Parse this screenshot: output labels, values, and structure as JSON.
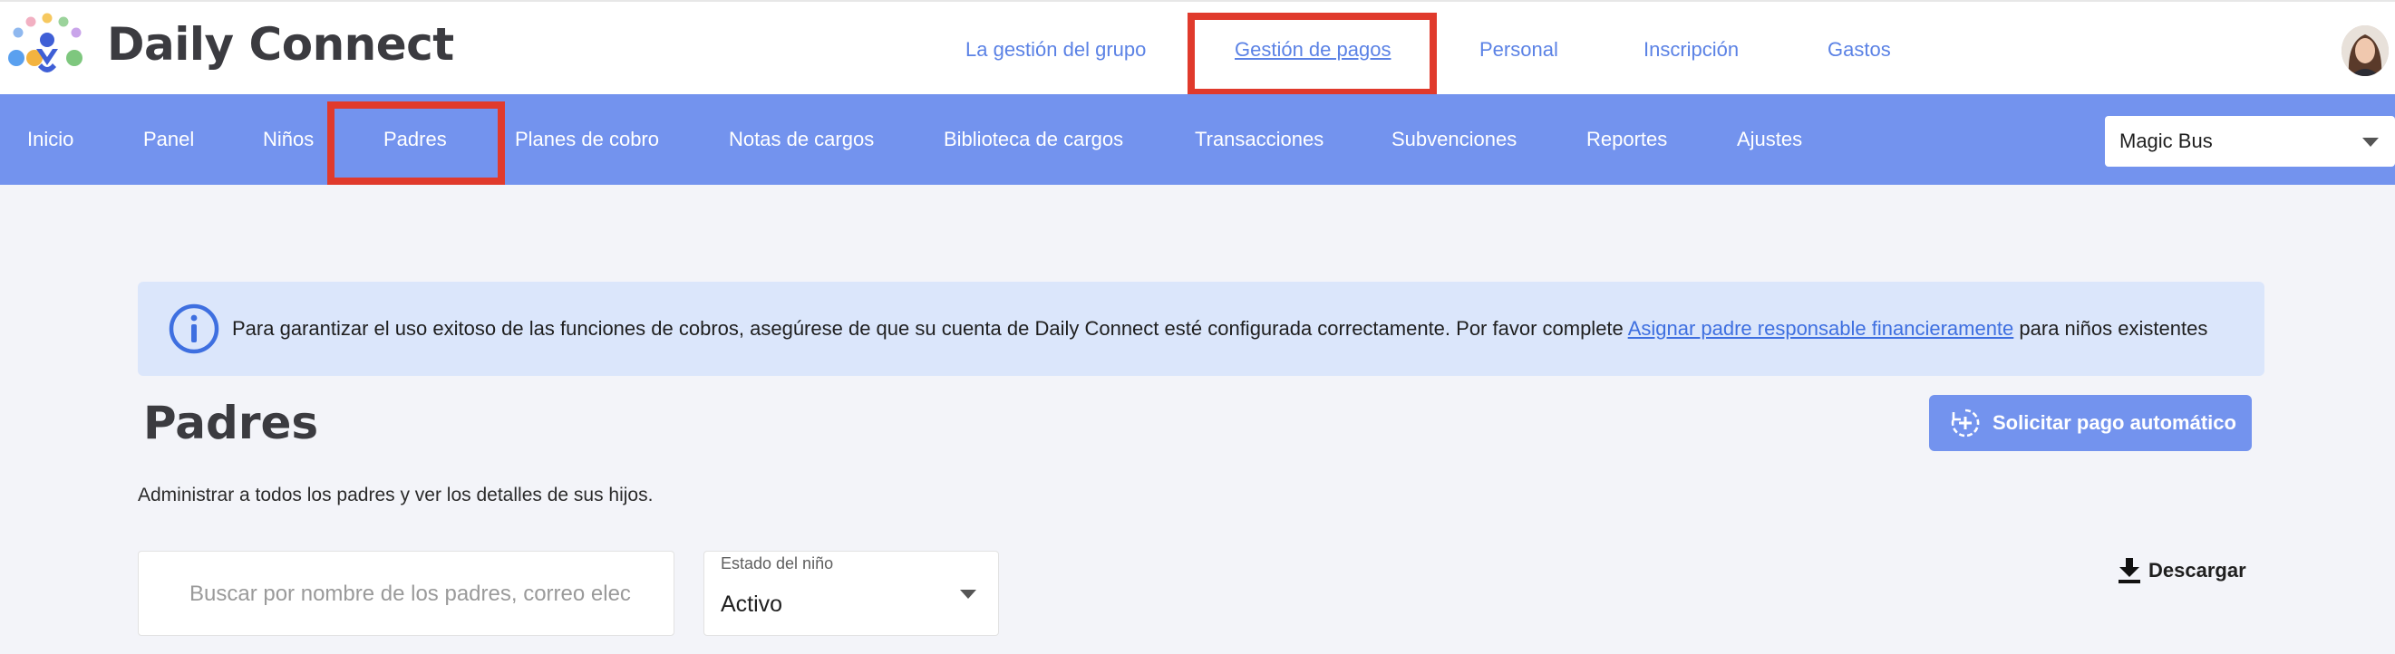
{
  "brand": {
    "name": "Daily Connect"
  },
  "top_nav": [
    {
      "label": "La gestión del grupo"
    },
    {
      "label": "Gestión de pagos",
      "active": true
    },
    {
      "label": "Personal"
    },
    {
      "label": "Inscripción"
    },
    {
      "label": "Gastos"
    }
  ],
  "sub_nav": [
    {
      "label": "Inicio"
    },
    {
      "label": "Panel"
    },
    {
      "label": "Niños"
    },
    {
      "label": "Padres",
      "active": true
    },
    {
      "label": "Planes de cobro"
    },
    {
      "label": "Notas de cargos"
    },
    {
      "label": "Biblioteca de cargos"
    },
    {
      "label": "Transacciones"
    },
    {
      "label": "Subvenciones"
    },
    {
      "label": "Reportes"
    },
    {
      "label": "Ajustes"
    }
  ],
  "center_select": {
    "value": "Magic Bus"
  },
  "banner": {
    "text_before": "Para garantizar el uso exitoso de las funciones de cobros, asegúrese de que su cuenta de Daily Connect esté configurada correctamente. Por favor complete ",
    "link": "Asignar padre responsable financieramente",
    "text_after": " para niños existentes"
  },
  "page": {
    "title": "Padres",
    "subtitle": "Administrar a todos los padres y ver los detalles de sus hijos.",
    "autopay_button": "Solicitar pago automático",
    "download_button": "Descargar"
  },
  "filters": {
    "search_placeholder": "Buscar por nombre de los padres, correo elec",
    "search_value": "",
    "status_label": "Estado del niño",
    "status_value": "Activo"
  },
  "colors": {
    "accent": "#7393ee",
    "link": "#5b82e5",
    "highlight": "#e03a2c",
    "banner_bg": "#dbe6fb"
  },
  "icons": {
    "logo": "daily-connect-logo",
    "info": "info-icon",
    "autopay": "autopay-icon",
    "download": "download-icon",
    "avatar": "user-avatar"
  }
}
